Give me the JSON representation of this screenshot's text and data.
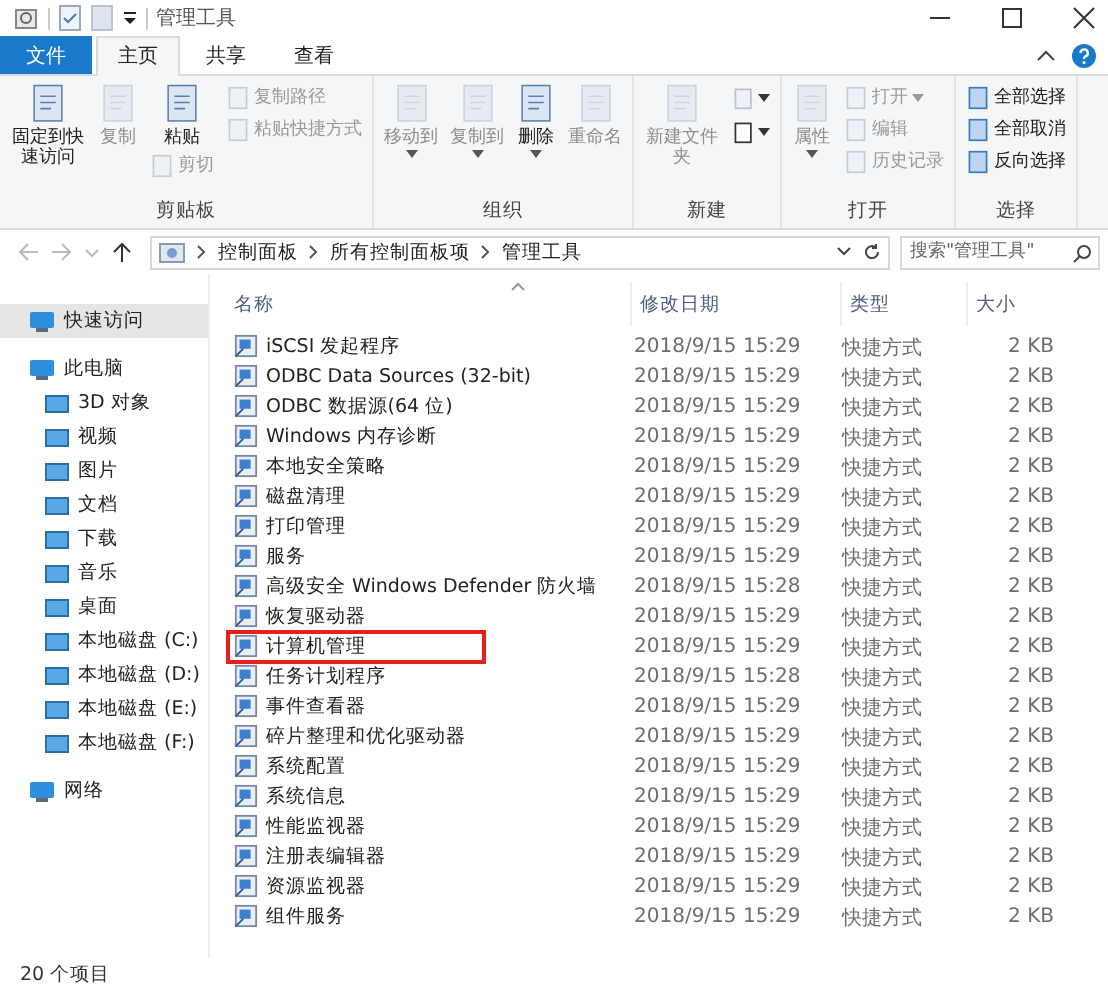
{
  "window": {
    "title": "管理工具"
  },
  "ribbon_tabs": [
    {
      "label": "文件",
      "kind": "file",
      "selected": false
    },
    {
      "label": "主页",
      "kind": "tab",
      "selected": true
    },
    {
      "label": "共享",
      "kind": "tab",
      "selected": false
    },
    {
      "label": "查看",
      "kind": "tab",
      "selected": false
    }
  ],
  "ribbon_groups": [
    {
      "label": "剪贴板",
      "columns": [
        [
          {
            "kind": "large",
            "label": "固定到快速访问",
            "disabled": false,
            "dropdown": false
          }
        ],
        [
          {
            "kind": "large",
            "label": "复制",
            "disabled": true,
            "dropdown": false
          }
        ],
        [
          {
            "kind": "large",
            "label": "粘贴",
            "disabled": false,
            "dropdown": false
          },
          {
            "kind": "small",
            "label": "剪切",
            "disabled": true,
            "dropdown": false
          }
        ],
        [
          {
            "kind": "small",
            "label": "复制路径",
            "disabled": true,
            "dropdown": false
          },
          {
            "kind": "small",
            "label": "粘贴快捷方式",
            "disabled": true,
            "dropdown": false
          }
        ]
      ]
    },
    {
      "label": "组织",
      "columns": [
        [
          {
            "kind": "large",
            "label": "移动到",
            "disabled": true,
            "dropdown": true
          }
        ],
        [
          {
            "kind": "large",
            "label": "复制到",
            "disabled": true,
            "dropdown": true
          }
        ],
        [
          {
            "kind": "large",
            "label": "删除",
            "disabled": false,
            "dropdown": true
          }
        ],
        [
          {
            "kind": "large",
            "label": "重命名",
            "disabled": true,
            "dropdown": false
          }
        ]
      ]
    },
    {
      "label": "新建",
      "columns": [
        [
          {
            "kind": "large",
            "label": "新建文件夹",
            "disabled": true,
            "dropdown": false
          }
        ],
        [
          {
            "kind": "icon",
            "disabled": true,
            "dropdown": true
          },
          {
            "kind": "icon",
            "disabled": false,
            "dropdown": true
          }
        ]
      ]
    },
    {
      "label": "打开",
      "columns": [
        [
          {
            "kind": "large",
            "label": "属性",
            "disabled": true,
            "dropdown": true
          }
        ],
        [
          {
            "kind": "small",
            "label": "打开",
            "disabled": true,
            "dropdown": true
          },
          {
            "kind": "small",
            "label": "编辑",
            "disabled": true,
            "dropdown": false
          },
          {
            "kind": "small",
            "label": "历史记录",
            "disabled": true,
            "dropdown": false
          }
        ]
      ]
    },
    {
      "label": "选择",
      "columns": [
        [
          {
            "kind": "small",
            "label": "全部选择",
            "disabled": false,
            "dropdown": false
          },
          {
            "kind": "small",
            "label": "全部取消",
            "disabled": false,
            "dropdown": false
          },
          {
            "kind": "small",
            "label": "反向选择",
            "disabled": false,
            "dropdown": false
          }
        ]
      ]
    }
  ],
  "address": {
    "path": [
      "控制面板",
      "所有控制面板项",
      "管理工具"
    ]
  },
  "search": {
    "placeholder": "搜索\"管理工具\""
  },
  "sidebar": {
    "items": [
      {
        "label": "快速访问",
        "selected": true
      },
      {
        "label": "此电脑",
        "selected": false,
        "children": [
          {
            "label": "3D 对象",
            "selected": false
          },
          {
            "label": "视频",
            "selected": false
          },
          {
            "label": "图片",
            "selected": false
          },
          {
            "label": "文档",
            "selected": false
          },
          {
            "label": "下载",
            "selected": false
          },
          {
            "label": "音乐",
            "selected": false
          },
          {
            "label": "桌面",
            "selected": false
          },
          {
            "label": "本地磁盘 (C:)",
            "selected": false
          },
          {
            "label": "本地磁盘 (D:)",
            "selected": false
          },
          {
            "label": "本地磁盘 (E:)",
            "selected": false
          },
          {
            "label": "本地磁盘 (F:)",
            "selected": false
          }
        ]
      },
      {
        "label": "网络",
        "selected": false
      }
    ]
  },
  "table": {
    "columns": [
      "名称",
      "修改日期",
      "类型",
      "大小"
    ],
    "rows": [
      {
        "name": "iSCSI 发起程序",
        "date": "2018/9/15 15:29",
        "type": "快捷方式",
        "size": "2 KB",
        "highlighted": false
      },
      {
        "name": "ODBC Data Sources (32-bit)",
        "date": "2018/9/15 15:29",
        "type": "快捷方式",
        "size": "2 KB",
        "highlighted": false
      },
      {
        "name": "ODBC 数据源(64 位)",
        "date": "2018/9/15 15:29",
        "type": "快捷方式",
        "size": "2 KB",
        "highlighted": false
      },
      {
        "name": "Windows 内存诊断",
        "date": "2018/9/15 15:29",
        "type": "快捷方式",
        "size": "2 KB",
        "highlighted": false
      },
      {
        "name": "本地安全策略",
        "date": "2018/9/15 15:29",
        "type": "快捷方式",
        "size": "2 KB",
        "highlighted": false
      },
      {
        "name": "磁盘清理",
        "date": "2018/9/15 15:29",
        "type": "快捷方式",
        "size": "2 KB",
        "highlighted": false
      },
      {
        "name": "打印管理",
        "date": "2018/9/15 15:29",
        "type": "快捷方式",
        "size": "2 KB",
        "highlighted": false
      },
      {
        "name": "服务",
        "date": "2018/9/15 15:29",
        "type": "快捷方式",
        "size": "2 KB",
        "highlighted": false
      },
      {
        "name": "高级安全 Windows Defender 防火墙",
        "date": "2018/9/15 15:28",
        "type": "快捷方式",
        "size": "2 KB",
        "highlighted": false
      },
      {
        "name": "恢复驱动器",
        "date": "2018/9/15 15:29",
        "type": "快捷方式",
        "size": "2 KB",
        "highlighted": false
      },
      {
        "name": "计算机管理",
        "date": "2018/9/15 15:29",
        "type": "快捷方式",
        "size": "2 KB",
        "highlighted": true
      },
      {
        "name": "任务计划程序",
        "date": "2018/9/15 15:28",
        "type": "快捷方式",
        "size": "2 KB",
        "highlighted": false
      },
      {
        "name": "事件查看器",
        "date": "2018/9/15 15:29",
        "type": "快捷方式",
        "size": "2 KB",
        "highlighted": false
      },
      {
        "name": "碎片整理和优化驱动器",
        "date": "2018/9/15 15:29",
        "type": "快捷方式",
        "size": "2 KB",
        "highlighted": false
      },
      {
        "name": "系统配置",
        "date": "2018/9/15 15:29",
        "type": "快捷方式",
        "size": "2 KB",
        "highlighted": false
      },
      {
        "name": "系统信息",
        "date": "2018/9/15 15:29",
        "type": "快捷方式",
        "size": "2 KB",
        "highlighted": false
      },
      {
        "name": "性能监视器",
        "date": "2018/9/15 15:29",
        "type": "快捷方式",
        "size": "2 KB",
        "highlighted": false
      },
      {
        "name": "注册表编辑器",
        "date": "2018/9/15 15:29",
        "type": "快捷方式",
        "size": "2 KB",
        "highlighted": false
      },
      {
        "name": "资源监视器",
        "date": "2018/9/15 15:29",
        "type": "快捷方式",
        "size": "2 KB",
        "highlighted": false
      },
      {
        "name": "组件服务",
        "date": "2018/9/15 15:29",
        "type": "快捷方式",
        "size": "2 KB",
        "highlighted": false
      }
    ]
  },
  "status_bar": {
    "text": "20 个项目"
  }
}
